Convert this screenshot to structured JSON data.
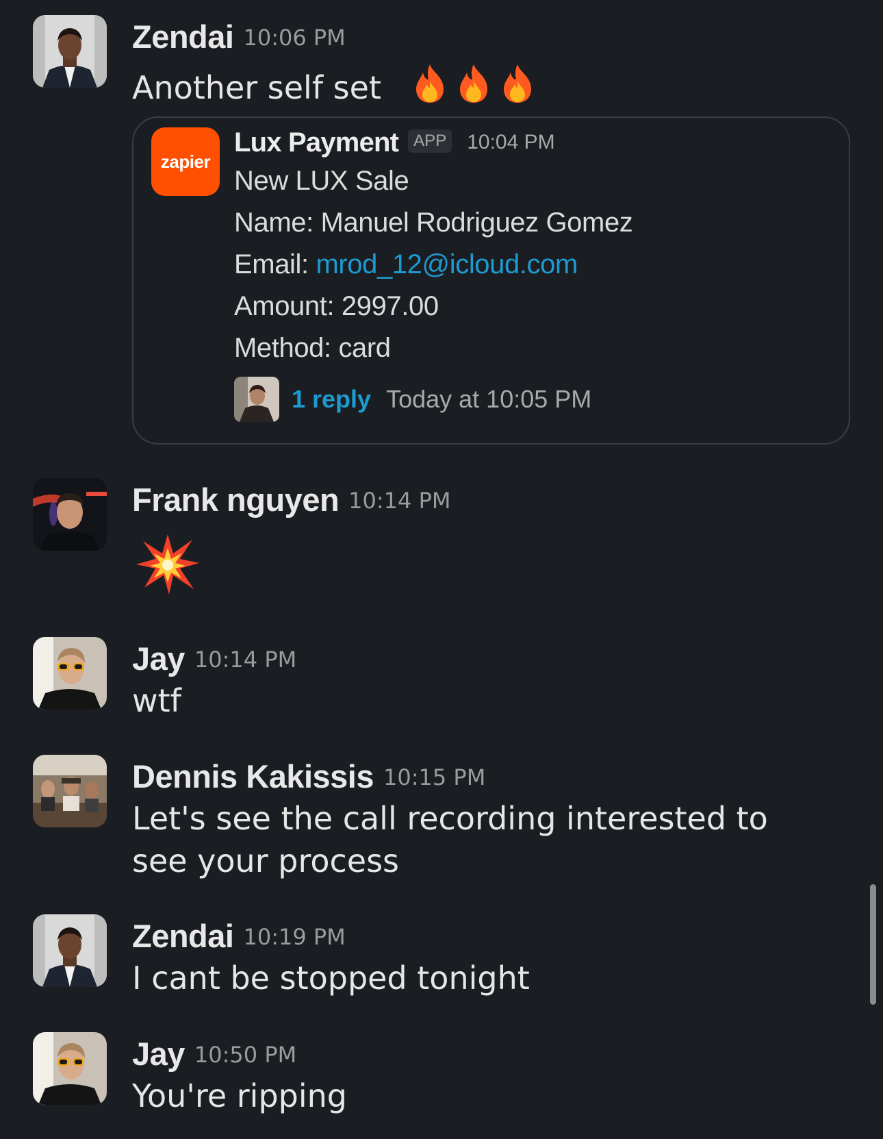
{
  "colors": {
    "background": "#1a1d21",
    "link": "#1d9bd1",
    "zapier_brand": "#ff4f00"
  },
  "messages": [
    {
      "author": "Zendai",
      "time": "10:06 PM",
      "text": "Another self set",
      "emoji": [
        "fire",
        "fire",
        "fire"
      ],
      "attachment": {
        "logo_text": "zapier",
        "author": "Lux Payment",
        "badge": "APP",
        "time": "10:04 PM",
        "title": "New LUX Sale",
        "name_line": "Name: Manuel  Rodriguez Gomez",
        "email_label": "Email: ",
        "email": "mrod_12@icloud.com",
        "amount_line": "Amount: 2997.00",
        "method_line": "Method: card",
        "reply_count": "1 reply",
        "reply_time": "Today at 10:05 PM"
      }
    },
    {
      "author": "Frank nguyen",
      "time": "10:14 PM",
      "emoji": [
        "collision"
      ]
    },
    {
      "author": "Jay",
      "time": "10:14 PM",
      "text": "wtf"
    },
    {
      "author": "Dennis Kakissis",
      "time": "10:15 PM",
      "text": "Let's see the call recording interested to see your process"
    },
    {
      "author": "Zendai",
      "time": "10:19 PM",
      "text": "I cant be stopped tonight"
    },
    {
      "author": "Jay",
      "time": "10:50 PM",
      "text": "You're ripping"
    }
  ]
}
